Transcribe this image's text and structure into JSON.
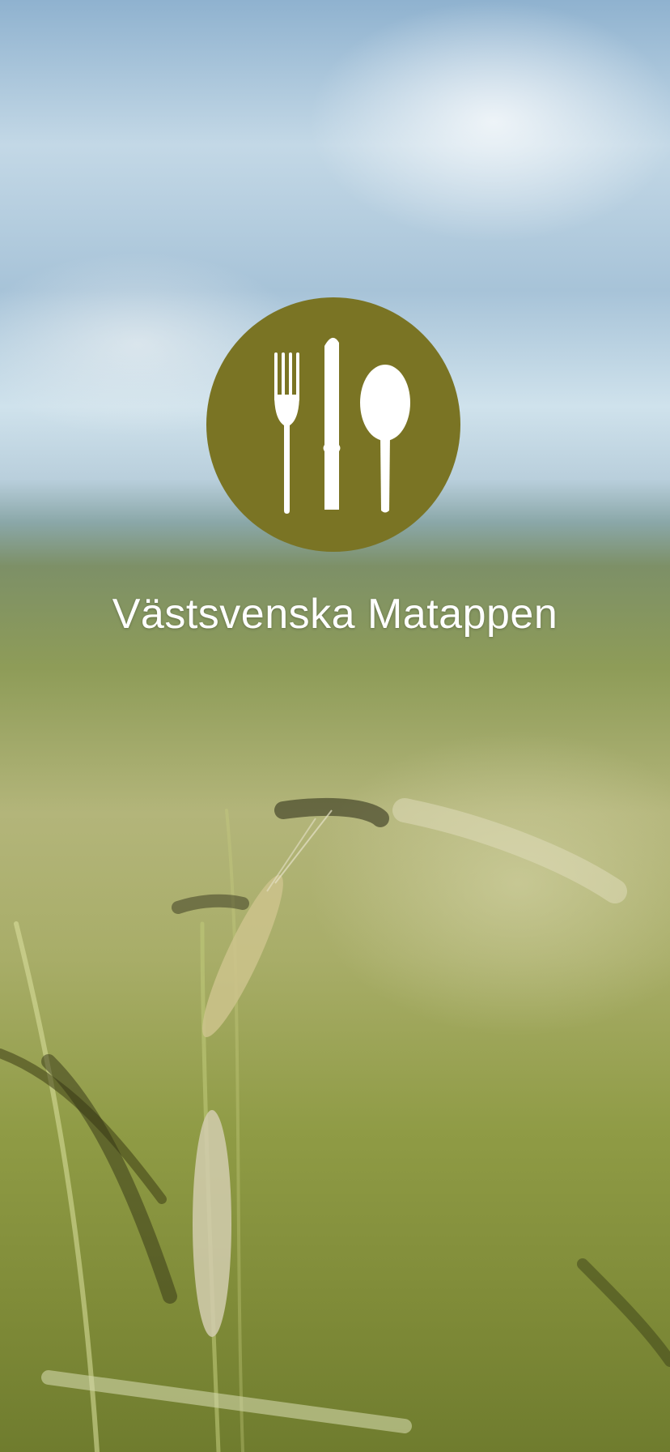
{
  "app": {
    "title": "Västsvenska Matappen"
  },
  "logo": {
    "icons": [
      "fork-icon",
      "knife-icon",
      "spoon-icon"
    ],
    "background_color": "#7a7424",
    "icon_color": "#ffffff"
  }
}
